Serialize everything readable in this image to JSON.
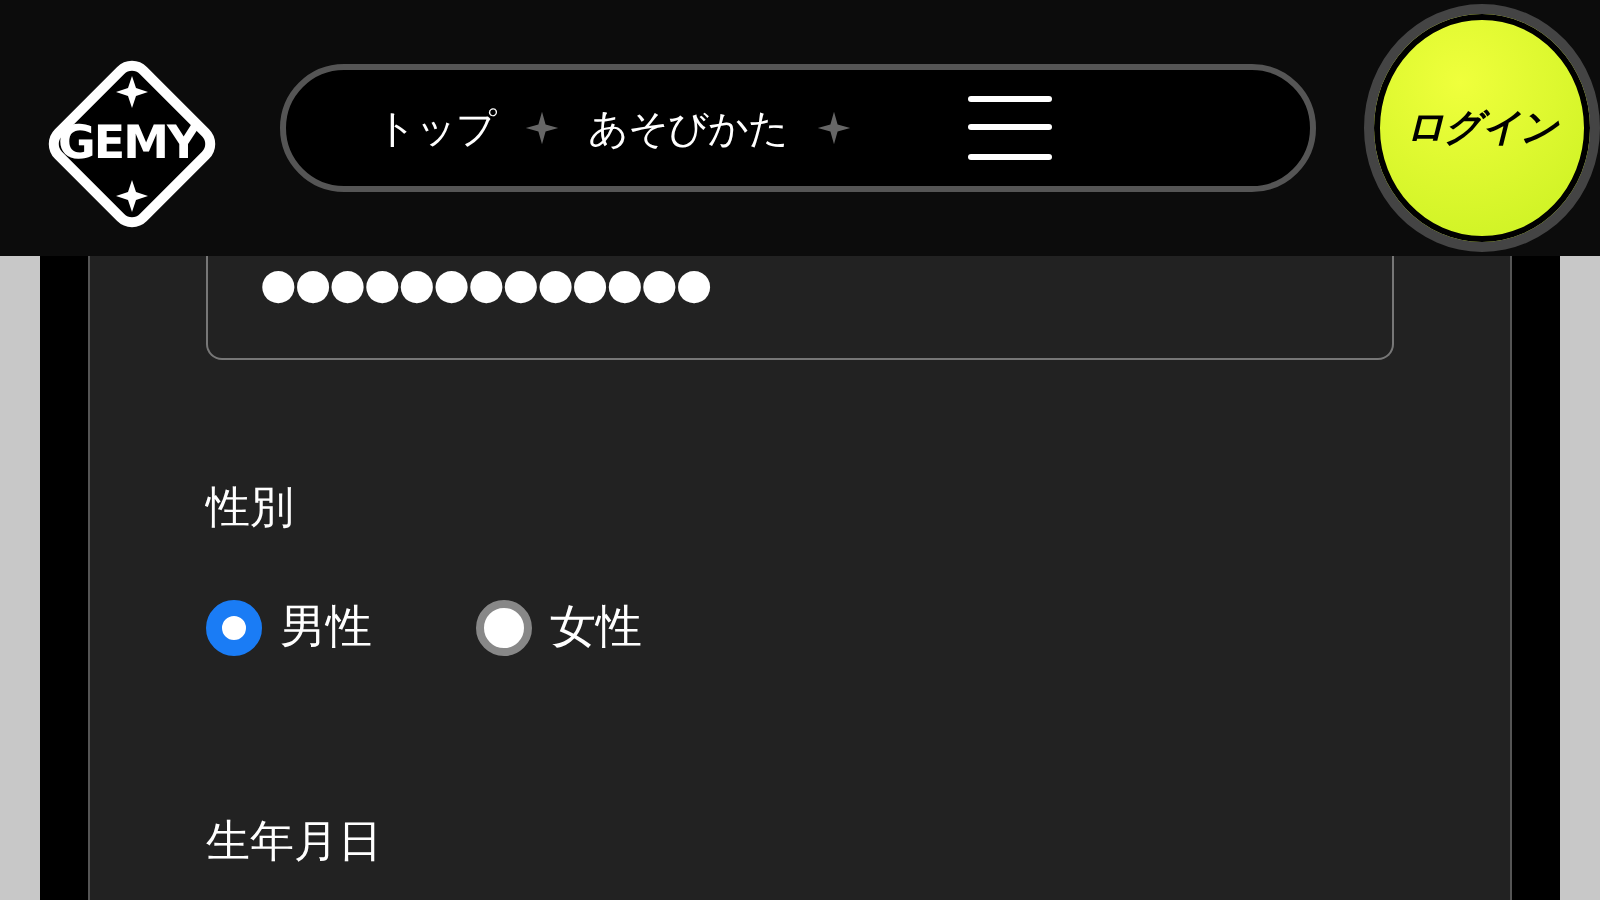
{
  "header": {
    "logo": "GEMY",
    "nav": [
      "トップ",
      "あそびかた"
    ],
    "login": "ログイン"
  },
  "form": {
    "password": {
      "value": "●●●●●●●●●●●●●"
    },
    "gender": {
      "label": "性別",
      "options": [
        {
          "label": "男性",
          "selected": true
        },
        {
          "label": "女性",
          "selected": false
        }
      ]
    },
    "birthday": {
      "label": "生年月日"
    }
  }
}
